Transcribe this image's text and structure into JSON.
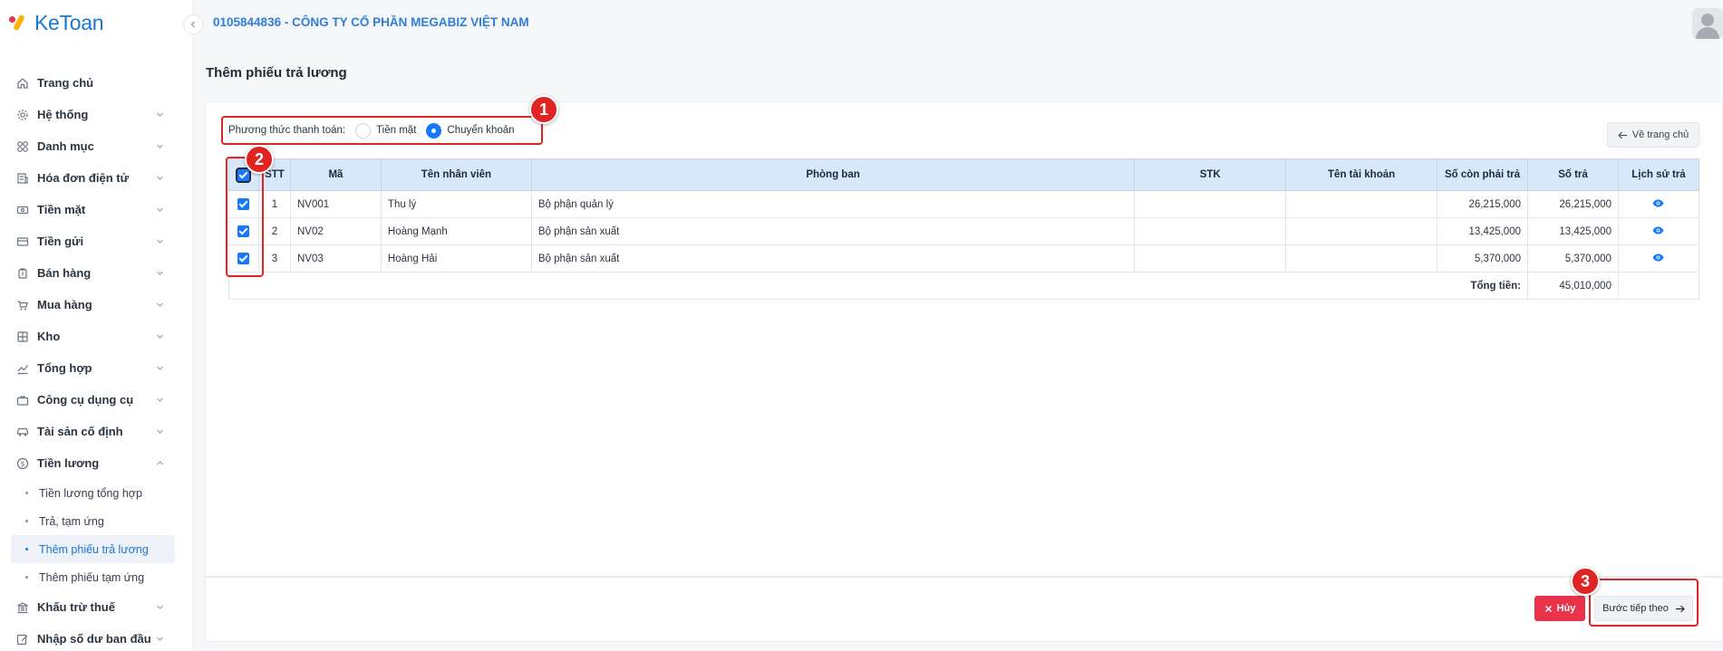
{
  "brand": {
    "name": "KeToan"
  },
  "header": {
    "company": "0105844836 - CÔNG TY CỔ PHẦN MEGABIZ VIỆT NAM"
  },
  "sidebar": {
    "items": [
      {
        "label": "Trang chủ",
        "icon": "home-icon"
      },
      {
        "label": "Hệ thống",
        "icon": "gear-icon"
      },
      {
        "label": "Danh mục",
        "icon": "grid-icon"
      },
      {
        "label": "Hóa đơn điện tử",
        "icon": "invoice-icon"
      },
      {
        "label": "Tiền mặt",
        "icon": "cash-icon"
      },
      {
        "label": "Tiền gửi",
        "icon": "card-icon"
      },
      {
        "label": "Bán hàng",
        "icon": "sales-icon"
      },
      {
        "label": "Mua hàng",
        "icon": "cart-icon"
      },
      {
        "label": "Kho",
        "icon": "warehouse-icon"
      },
      {
        "label": "Tổng hợp",
        "icon": "chart-icon"
      },
      {
        "label": "Công cụ dụng cụ",
        "icon": "tools-icon"
      },
      {
        "label": "Tài sản cố định",
        "icon": "car-icon"
      },
      {
        "label": "Tiền lương",
        "icon": "salary-icon"
      },
      {
        "label": "Khấu trừ thuế",
        "icon": "bank-icon"
      },
      {
        "label": "Nhập số dư ban đầu",
        "icon": "edit-icon"
      }
    ],
    "salary_sub": [
      {
        "label": "Tiền lương tổng hợp"
      },
      {
        "label": "Trả, tạm ứng"
      },
      {
        "label": "Thêm phiếu trả lương",
        "active": true
      },
      {
        "label": "Thêm phiếu tạm ứng"
      }
    ]
  },
  "page": {
    "title": "Thêm phiếu trả lương",
    "back_label": "Về trang chủ"
  },
  "payment": {
    "label": "Phương thức thanh toán:",
    "options": [
      {
        "label": "Tiền mặt",
        "selected": false
      },
      {
        "label": "Chuyển khoản",
        "selected": true
      }
    ]
  },
  "table": {
    "headers": [
      "STT",
      "Mã",
      "Tên nhân viên",
      "Phòng ban",
      "STK",
      "Tên tài khoản",
      "Số còn phải trả",
      "Số trả",
      "Lịch sử trả"
    ],
    "rows": [
      {
        "stt": "1",
        "code": "NV001",
        "name": "Thu lý",
        "department": "Bộ phận quản lý",
        "stk": "",
        "account_name": "",
        "remaining": "26,215,000",
        "paid": "26,215,000",
        "checked": true
      },
      {
        "stt": "2",
        "code": "NV02",
        "name": "Hoàng Mạnh",
        "department": "Bộ phận sản xuất",
        "stk": "",
        "account_name": "",
        "remaining": "13,425,000",
        "paid": "13,425,000",
        "checked": true
      },
      {
        "stt": "3",
        "code": "NV03",
        "name": "Hoàng Hải",
        "department": "Bộ phận sản xuất",
        "stk": "",
        "account_name": "",
        "remaining": "5,370,000",
        "paid": "5,370,000",
        "checked": true
      }
    ],
    "total_label": "Tổng tiền:",
    "total_value": "45,010,000"
  },
  "footer": {
    "cancel_label": "Hủy",
    "next_label": "Bước tiếp theo"
  },
  "annotations": [
    "1",
    "2",
    "3"
  ],
  "colors": {
    "accent": "#1677ff",
    "danger": "#e8334a",
    "annotation": "#e02424",
    "table_header": "#d6e8fa"
  }
}
